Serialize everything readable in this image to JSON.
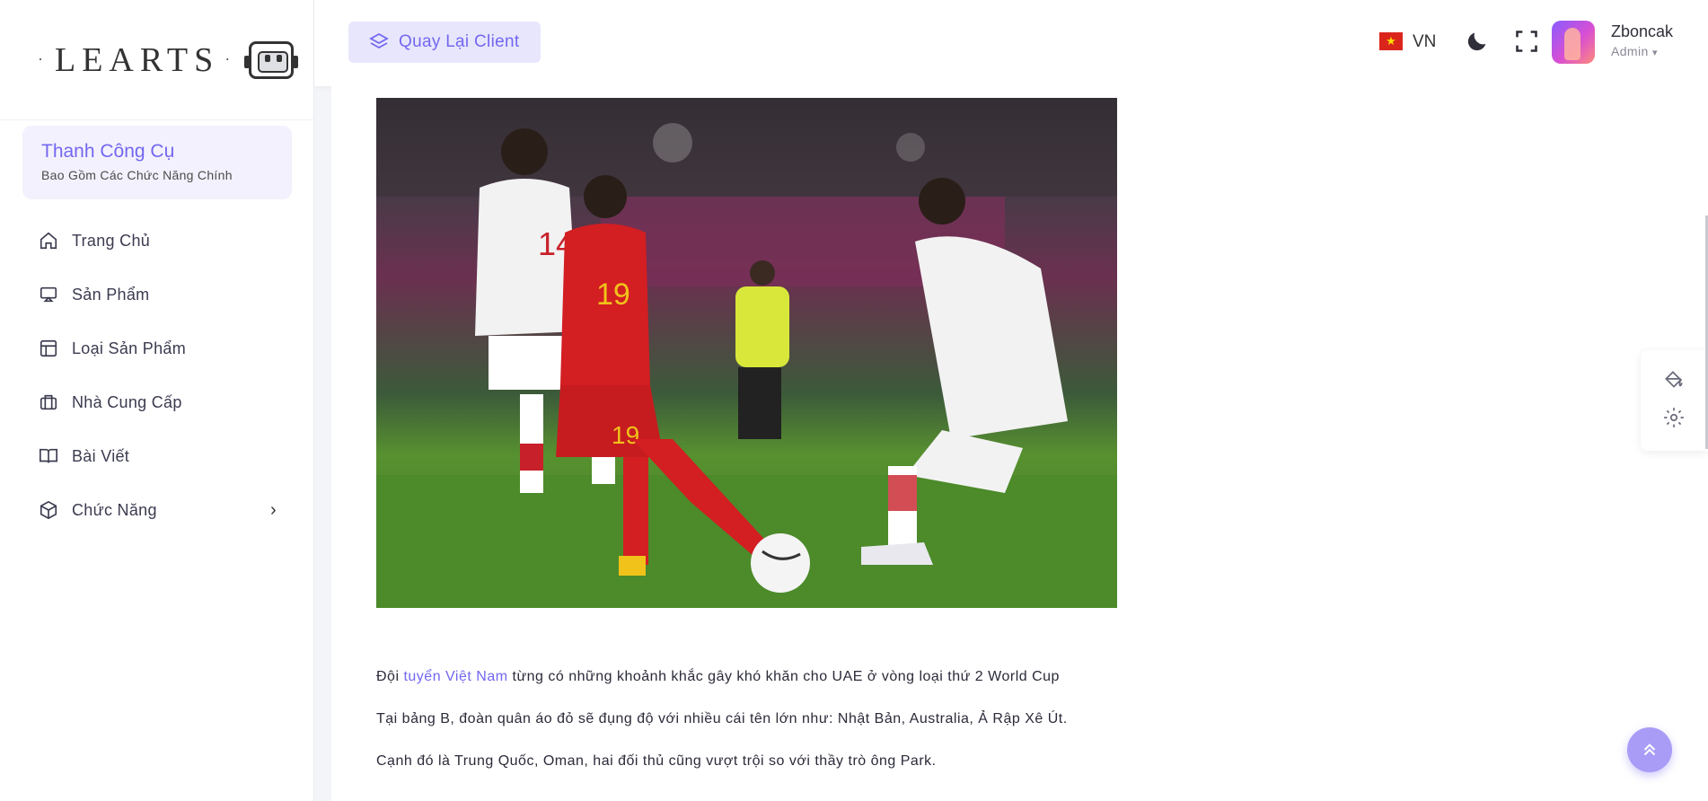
{
  "app": {
    "logo_text": "LEARTS",
    "logo_left_dot": "·",
    "logo_right_dot": "·"
  },
  "sidebar": {
    "tool_card": {
      "title": "Thanh Công Cụ",
      "subtitle": "Bao Gồm Các Chức Năng Chính"
    },
    "items": [
      {
        "label": "Trang Chủ",
        "icon": "home-icon"
      },
      {
        "label": "Sản Phẩm",
        "icon": "monitor-icon"
      },
      {
        "label": "Loại Sản Phẩm",
        "icon": "layout-icon"
      },
      {
        "label": "Nhà Cung Cấp",
        "icon": "briefcase-icon"
      },
      {
        "label": "Bài Viết",
        "icon": "book-icon"
      },
      {
        "label": "Chức Năng",
        "icon": "box-icon",
        "has_submenu": true
      }
    ]
  },
  "header": {
    "back_button": "Quay Lại Client",
    "language": "VN",
    "user_name": "Zboncak",
    "user_role": "Admin"
  },
  "article": {
    "p1_prefix": "Đội ",
    "p1_link": "tuyển Việt Nam",
    "p1_suffix": " từng có những khoảnh khắc gây khó khăn cho UAE ở vòng loại thứ 2 World Cup",
    "p2": "Tại bảng B, đoàn quân áo đỏ sẽ đụng độ với nhiều cái tên lớn như: Nhật Bản, Australia, Ả Rập Xê Út.",
    "p3": "Cạnh đó là Trung Quốc, Oman, hai đối thủ cũng vượt trội so với thầy trò ông Park.",
    "image_alt": "Football match: Vietnam player in red shirt number 19 dribbling between UAE players in white",
    "jersey_numbers": [
      "14",
      "19",
      "19"
    ]
  },
  "colors": {
    "accent": "#7367f0",
    "accent_light": "#e8e6fc",
    "flag_red": "#da251d",
    "flag_star": "#ffde00"
  }
}
